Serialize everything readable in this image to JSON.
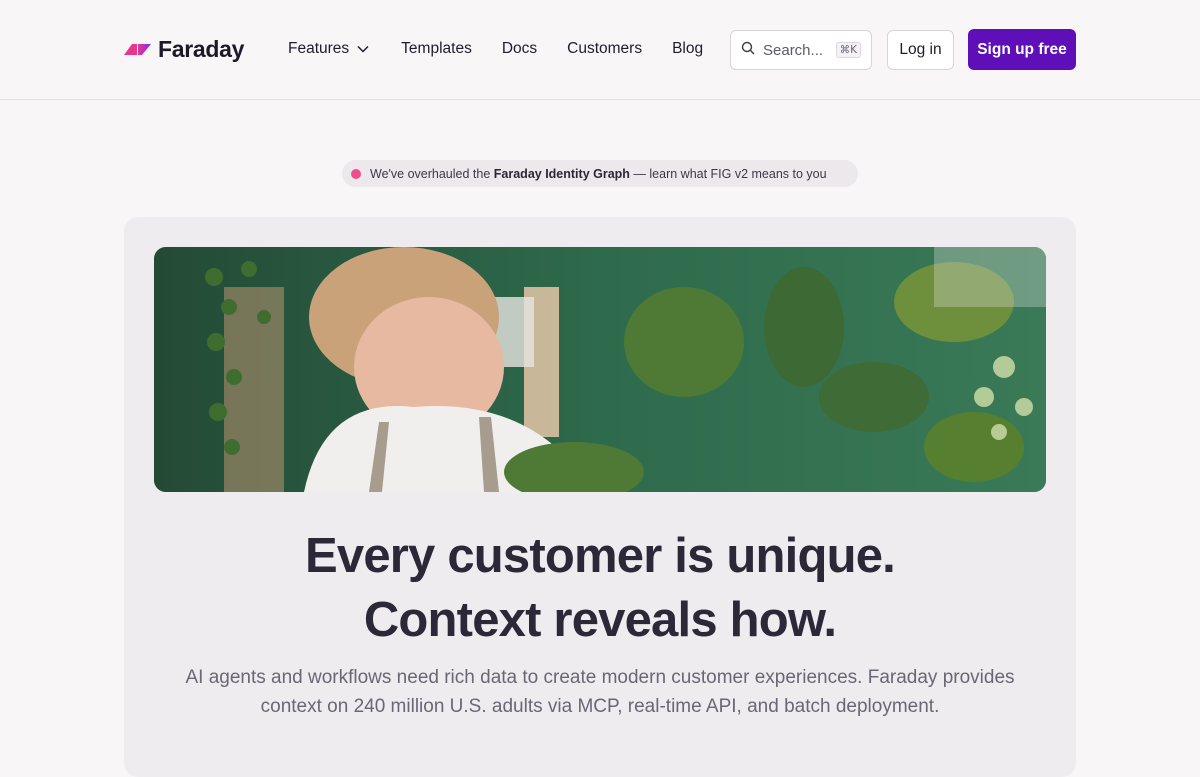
{
  "header": {
    "logo_text": "Faraday",
    "nav": {
      "features": "Features",
      "templates": "Templates",
      "docs": "Docs",
      "customers": "Customers",
      "blog": "Blog"
    },
    "search": {
      "placeholder": "Search...",
      "shortcut": "⌘K"
    },
    "login_label": "Log in",
    "signup_label": "Sign up free"
  },
  "announcement": {
    "prefix": "We've overhauled the",
    "highlight": "Faraday Identity Graph",
    "suffix": "— learn what FIG v2 means to you"
  },
  "hero": {
    "headline_line1": "Every customer is unique.",
    "headline_line2": "Context reveals how.",
    "subtext": "AI agents and workflows need rich data to create modern customer experiences. Faraday provides context on 240 million U.S. adults via MCP, real-time API, and batch deployment."
  },
  "colors": {
    "accent": "#5e0fb8",
    "announcement_dot": "#ee4d8c",
    "logo_gradient_start": "#e8378f",
    "logo_gradient_end": "#7b2ff0"
  },
  "icons": {
    "logo": "faraday-logo-icon",
    "features_chevron": "chevron-down-icon",
    "search": "search-icon"
  }
}
